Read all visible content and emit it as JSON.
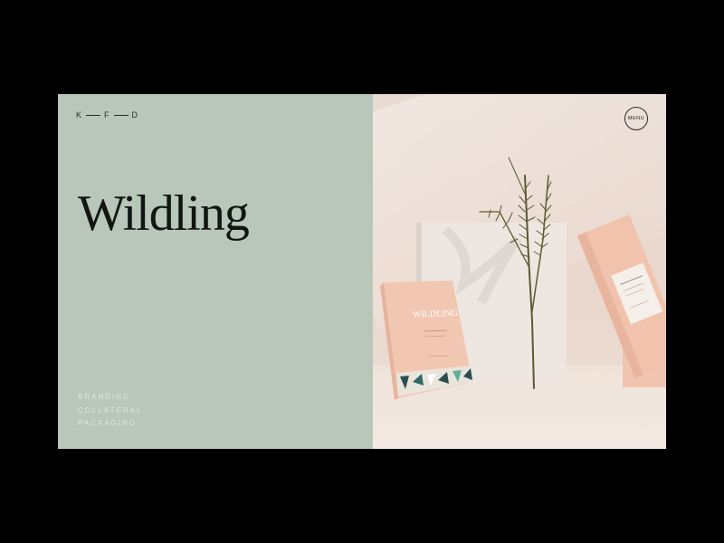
{
  "brand": {
    "logo": [
      "K",
      "F",
      "D"
    ]
  },
  "header": {
    "menu_label": "MENU"
  },
  "hero": {
    "title": "Wildling"
  },
  "services": [
    "BRANDING",
    "COLLATERAL",
    "PACKAGING"
  ],
  "product": {
    "box_brand": "WILDLING"
  },
  "colors": {
    "left_panel": "#b8c7b9",
    "right_panel": "#eadbd2",
    "box": "#f1c5ad",
    "stem": "#5b5a30"
  }
}
